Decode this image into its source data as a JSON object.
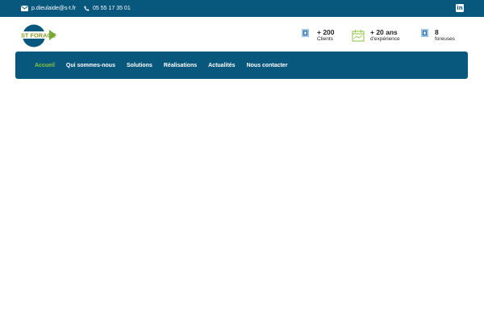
{
  "topbar": {
    "email": "p.dieulaide@s-t.fr",
    "phone": "05 55 17 35 01",
    "icons": {
      "email": "envelope-icon",
      "phone": "phone-icon",
      "social": "linkedin-icon"
    },
    "linkedin_glyph": "in"
  },
  "logo": {
    "text": "ST FORAGE"
  },
  "stats": [
    {
      "icon": "clients-icon",
      "number": "+ 200",
      "label": "Clients"
    },
    {
      "icon": "experience-icon",
      "number": "+ 20 ans",
      "label": "d'expérience"
    },
    {
      "icon": "drill-icon",
      "number": "8",
      "label": "foreuses"
    }
  ],
  "nav": {
    "items": [
      {
        "label": "Accueil",
        "active": true
      },
      {
        "label": "Qui sommes-nous",
        "active": false
      },
      {
        "label": "Solutions",
        "active": false
      },
      {
        "label": "Réalisations",
        "active": false
      },
      {
        "label": "Actualités",
        "active": false
      },
      {
        "label": "Nous contacter",
        "active": false
      }
    ]
  },
  "colors": {
    "brand_blue": "#08577c",
    "accent_green": "#8dc63f",
    "logo_green": "#6cb33e",
    "logo_olive": "#8a9a2b"
  }
}
